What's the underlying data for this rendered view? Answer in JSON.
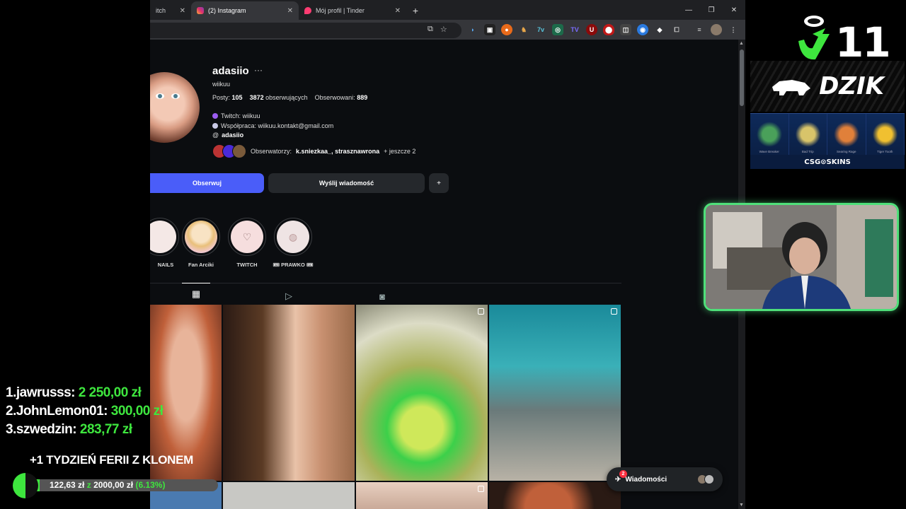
{
  "browser": {
    "tabs": [
      {
        "title": "itch",
        "active": false
      },
      {
        "title": "(2) Instagram",
        "active": true
      },
      {
        "title": "Mój profil | Tinder",
        "active": false
      }
    ],
    "new_tab": "+",
    "window_controls": [
      "—",
      "❐",
      "✕"
    ]
  },
  "profile": {
    "username": "adasiio",
    "more": "···",
    "full_name": "wiikuu",
    "stats": {
      "posts_label": "Posty:",
      "posts": "105",
      "followers": "3872",
      "followers_label": "obserwujących",
      "following_label": "Obserwowani:",
      "following": "889"
    },
    "bio": {
      "line1": "Twitch: wiikuu",
      "line2": "Współpraca: wiikuu.kontakt@gmail.com",
      "threads": "adasiio"
    },
    "followed_by": {
      "prefix": "Obserwatorzy:",
      "names": "k.sniezkaa_, strasznawrona",
      "suffix": "+ jeszcze 2"
    },
    "buttons": {
      "follow": "Obserwuj",
      "message": "Wyślij wiadomość",
      "add": "+"
    },
    "highlights": [
      {
        "label": "NAILS"
      },
      {
        "label": "Fan Arciki"
      },
      {
        "label": "TWITCH"
      },
      {
        "label": "🎟 PRAWKO 🎟"
      }
    ],
    "messages_label": "Wiadomości",
    "messages_badge": "2"
  },
  "overlay": {
    "sponsor_number": "11",
    "sponsor_name": "DZIK",
    "csgo_label": "CSG⊙SKINS",
    "csgo_skins": [
      "Wave Breaker",
      "Bad Trip",
      "Searing Rage",
      "Tiger Tooth"
    ],
    "donors": [
      {
        "rank": "1.",
        "name": "jawrusss:",
        "amount": "2 250,00 zł"
      },
      {
        "rank": "2.",
        "name": "JohnLemon01:",
        "amount": "300,00 zł"
      },
      {
        "rank": "3.",
        "name": "szwedzin:",
        "amount": "283,77 zł"
      }
    ],
    "promo": "+1 TYDZIEŃ FERII Z KLONEM",
    "goal": {
      "current": "122,63 zł",
      "sep": "z",
      "target": "2000,00 zł",
      "pct": "(6.13%)",
      "fraction": 0.0613
    }
  },
  "colors": {
    "accent": "#4a5df9",
    "stream_green": "#3ee63e",
    "cam_border": "#4fe07a"
  }
}
